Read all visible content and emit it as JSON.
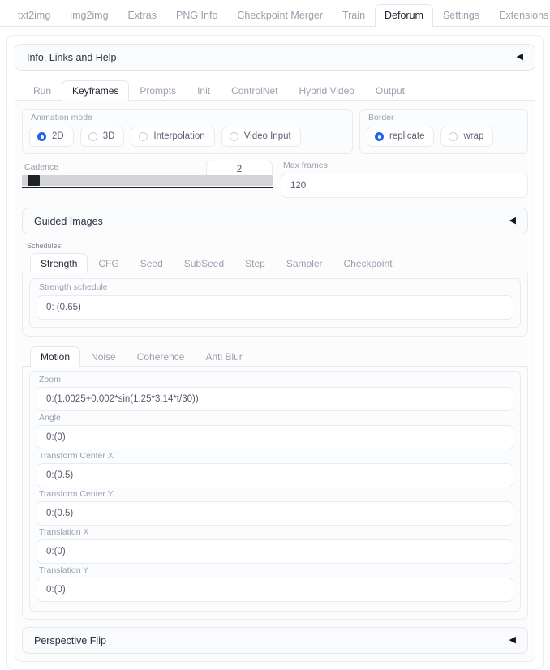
{
  "topnav": {
    "tabs": [
      {
        "label": "txt2img",
        "active": false
      },
      {
        "label": "img2img",
        "active": false
      },
      {
        "label": "Extras",
        "active": false
      },
      {
        "label": "PNG Info",
        "active": false
      },
      {
        "label": "Checkpoint Merger",
        "active": false
      },
      {
        "label": "Train",
        "active": false
      },
      {
        "label": "Deforum",
        "active": true
      },
      {
        "label": "Settings",
        "active": false
      },
      {
        "label": "Extensions",
        "active": false
      }
    ]
  },
  "info_accordion": {
    "title": "Info, Links and Help",
    "arrow": "◀"
  },
  "deforum_tabs": [
    {
      "label": "Run",
      "active": false
    },
    {
      "label": "Keyframes",
      "active": true
    },
    {
      "label": "Prompts",
      "active": false
    },
    {
      "label": "Init",
      "active": false
    },
    {
      "label": "ControlNet",
      "active": false
    },
    {
      "label": "Hybrid Video",
      "active": false
    },
    {
      "label": "Output",
      "active": false
    }
  ],
  "animation_mode": {
    "label": "Animation mode",
    "options": [
      {
        "label": "2D",
        "selected": true
      },
      {
        "label": "3D",
        "selected": false
      },
      {
        "label": "Interpolation",
        "selected": false
      },
      {
        "label": "Video Input",
        "selected": false
      }
    ]
  },
  "border": {
    "label": "Border",
    "options": [
      {
        "label": "replicate",
        "selected": true
      },
      {
        "label": "wrap",
        "selected": false
      }
    ]
  },
  "cadence": {
    "label": "Cadence",
    "value": "2"
  },
  "max_frames": {
    "label": "Max frames",
    "value": "120"
  },
  "guided_images_accordion": {
    "title": "Guided Images",
    "arrow": "◀"
  },
  "schedules": {
    "label": "Schedules:",
    "tabs": [
      {
        "label": "Strength",
        "active": true
      },
      {
        "label": "CFG",
        "active": false
      },
      {
        "label": "Seed",
        "active": false
      },
      {
        "label": "SubSeed",
        "active": false
      },
      {
        "label": "Step",
        "active": false
      },
      {
        "label": "Sampler",
        "active": false
      },
      {
        "label": "Checkpoint",
        "active": false
      }
    ],
    "strength_schedule": {
      "label": "Strength schedule",
      "value": "0: (0.65)"
    }
  },
  "motion": {
    "tabs": [
      {
        "label": "Motion",
        "active": true
      },
      {
        "label": "Noise",
        "active": false
      },
      {
        "label": "Coherence",
        "active": false
      },
      {
        "label": "Anti Blur",
        "active": false
      }
    ],
    "fields": [
      {
        "label": "Zoom",
        "value": "0:(1.0025+0.002*sin(1.25*3.14*t/30))"
      },
      {
        "label": "Angle",
        "value": "0:(0)"
      },
      {
        "label": "Transform Center X",
        "value": "0:(0.5)"
      },
      {
        "label": "Transform Center Y",
        "value": "0:(0.5)"
      },
      {
        "label": "Translation X",
        "value": "0:(0)"
      },
      {
        "label": "Translation Y",
        "value": "0:(0)"
      }
    ]
  },
  "perspective_flip_accordion": {
    "title": "Perspective Flip",
    "arrow": "◀"
  },
  "colors": {
    "accent": "#2563eb",
    "border": "#e9ebef",
    "muted_text": "#9aa0ae",
    "active_text": "#1f2330"
  }
}
